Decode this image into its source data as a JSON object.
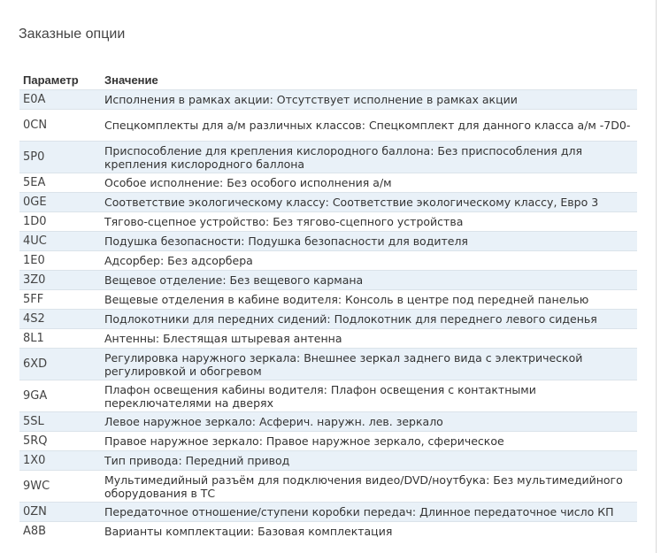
{
  "section": {
    "title": "Заказные опции"
  },
  "table": {
    "headers": {
      "param": "Параметр",
      "value": "Значение"
    },
    "rows": [
      {
        "code": "E0A",
        "value": "Исполнения в рамках акции: Отсутствует исполнение в рамках акции"
      },
      {
        "code": "0CN",
        "value": "Спецкомплекты для а/м различных классов: Спецкомплект для данного класса а/м -7D0-"
      },
      {
        "code": "5P0",
        "value": "Приспособление для крепления кислородного баллона: Без приспособления для крепления кислородного баллона"
      },
      {
        "code": "5EA",
        "value": "Особое исполнение: Без особого исполнения а/м"
      },
      {
        "code": "0GE",
        "value": "Соответствие экологическому классу: Соответствие экологическому классу, Евро 3"
      },
      {
        "code": "1D0",
        "value": "Тягово-сцепное устройство: Без тягово-сцепного устройства"
      },
      {
        "code": "4UC",
        "value": "Подушка безопасности: Подушка безопасности для водителя"
      },
      {
        "code": "1E0",
        "value": "Адсорбер: Без адсорбера"
      },
      {
        "code": "3Z0",
        "value": "Вещевое отделение: Без вещевого кармана"
      },
      {
        "code": "5FF",
        "value": "Вещевые отделения в кабине водителя: Консоль в центре под передней панелью"
      },
      {
        "code": "4S2",
        "value": "Подлокотники для передних сидений: Подлокотник для переднего левого сиденья"
      },
      {
        "code": "8L1",
        "value": "Антенны: Блестящая штыревая антенна"
      },
      {
        "code": "6XD",
        "value": "Регулировка наружного зеркала: Внешнее зеркал заднего вида с электрической регулировкой и обогревом"
      },
      {
        "code": "9GA",
        "value": "Плафон освещения кабины водителя: Плафон освещения с контактными переключателями на дверях"
      },
      {
        "code": "5SL",
        "value": "Левое наружное зеркало: Асферич. наружн. лев. зеркало"
      },
      {
        "code": "5RQ",
        "value": "Правое наружное зеркало: Правое наружное зеркало, сферическое"
      },
      {
        "code": "1X0",
        "value": "Тип привода: Передний привод"
      },
      {
        "code": "9WC",
        "value": "Мультимедийный разъём для подключения видео/DVD/ноутбука: Без мультимедийного оборудования в ТС"
      },
      {
        "code": "0ZN",
        "value": "Передаточное отношение/ступени коробки передач: Длинное передаточное число КП"
      },
      {
        "code": "A8B",
        "value": "Варианты комплектации: Базовая комплектация"
      }
    ]
  }
}
